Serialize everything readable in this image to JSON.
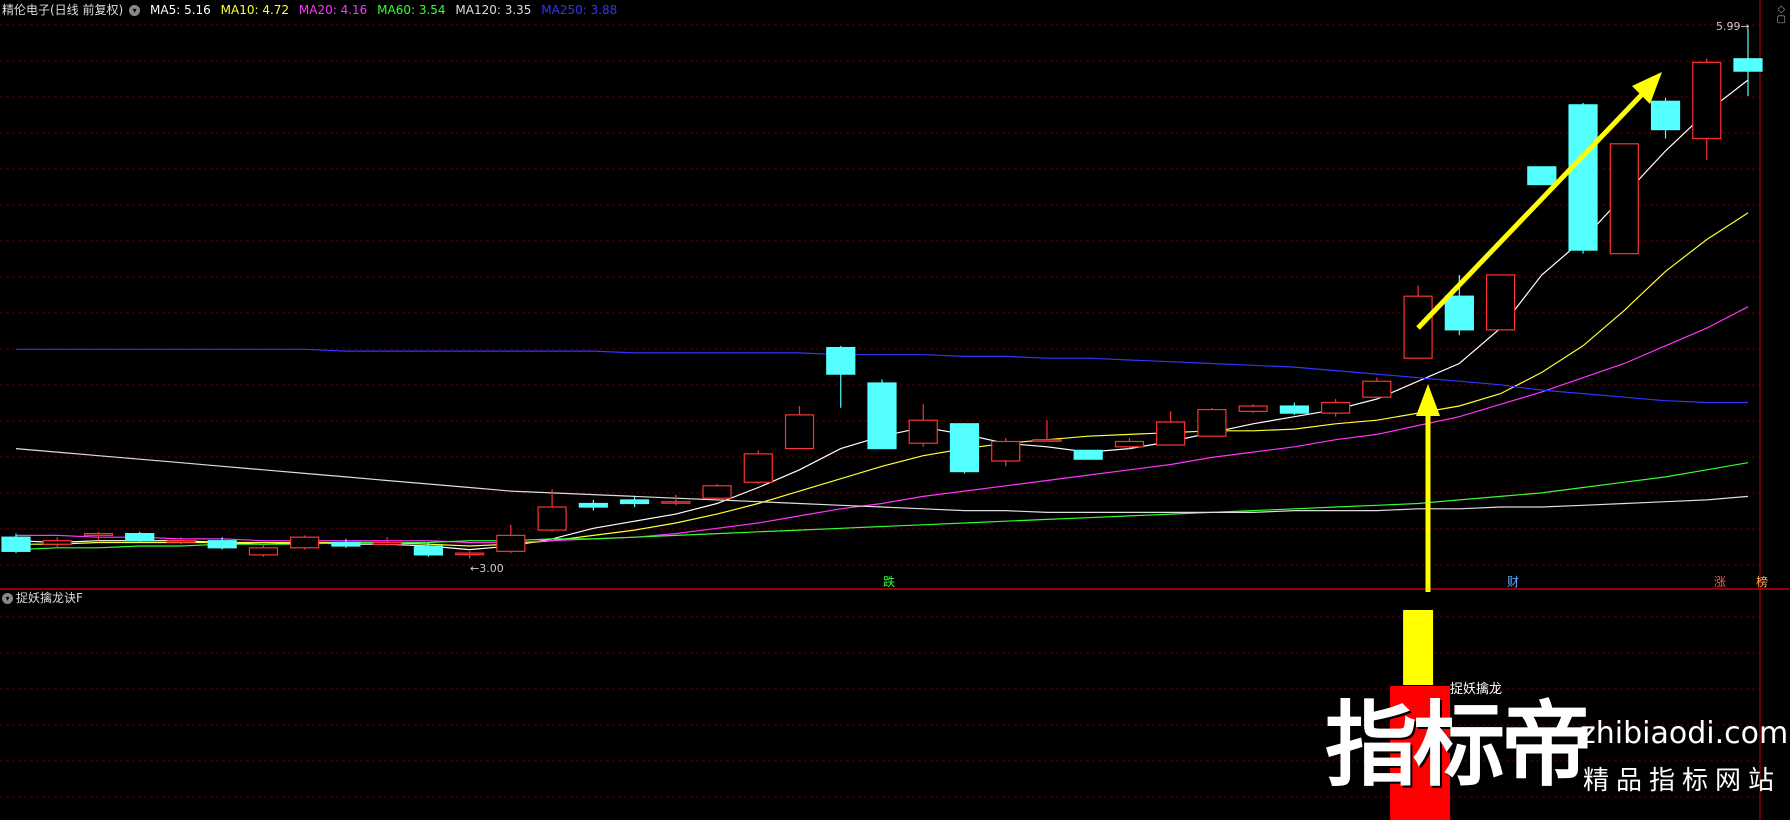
{
  "header": {
    "stock_name": "精伦电子(日线 前复权)",
    "ma": [
      {
        "label": "MA5: 5.16",
        "color": "#ffffff"
      },
      {
        "label": "MA10: 4.72",
        "color": "#ffff33"
      },
      {
        "label": "MA20: 4.16",
        "color": "#ff33ff"
      },
      {
        "label": "MA60: 3.54",
        "color": "#33ff33"
      },
      {
        "label": "MA120: 3.35",
        "color": "#dddddd"
      },
      {
        "label": "MA250: 3.88",
        "color": "#3333ff"
      }
    ]
  },
  "sub_indicator": {
    "title": "捉妖擒龙诀F",
    "signal_label": "捉妖擒龙"
  },
  "markers": [
    {
      "text": "跌",
      "color": "#33ff33"
    },
    {
      "text": "财",
      "color": "#66aaff"
    },
    {
      "text": "涨",
      "color": "#ff5555"
    },
    {
      "text": "榜",
      "color": "#ffaa55"
    }
  ],
  "watermark": {
    "cn": "指标帝",
    "en": "zhibiaodi.com",
    "sub": "精品指标网站"
  },
  "chart_data": {
    "type": "candlestick",
    "title": "",
    "ylim": [
      2.85,
      6.05
    ],
    "high_label": "5.99",
    "low_label": "3.00",
    "candles": [
      [
        3.12,
        3.04,
        3.14,
        3.03
      ],
      [
        3.08,
        3.1,
        3.12,
        3.06
      ],
      [
        3.13,
        3.14,
        3.15,
        3.1
      ],
      [
        3.14,
        3.1,
        3.15,
        3.09
      ],
      [
        3.1,
        3.1,
        3.12,
        3.08
      ],
      [
        3.1,
        3.06,
        3.12,
        3.05
      ],
      [
        3.02,
        3.06,
        3.08,
        3.01
      ],
      [
        3.06,
        3.12,
        3.13,
        3.05
      ],
      [
        3.09,
        3.07,
        3.11,
        3.06
      ],
      [
        3.08,
        3.09,
        3.12,
        3.07
      ],
      [
        3.07,
        3.02,
        3.09,
        3.01
      ],
      [
        3.03,
        3.03,
        3.04,
        3.0
      ],
      [
        3.04,
        3.13,
        3.19,
        3.03
      ],
      [
        3.16,
        3.29,
        3.39,
        3.15
      ],
      [
        3.31,
        3.29,
        3.33,
        3.27
      ],
      [
        3.33,
        3.31,
        3.35,
        3.29
      ],
      [
        3.32,
        3.32,
        3.36,
        3.3
      ],
      [
        3.34,
        3.41,
        3.42,
        3.33
      ],
      [
        3.43,
        3.59,
        3.61,
        3.42
      ],
      [
        3.62,
        3.81,
        3.86,
        3.64
      ],
      [
        4.19,
        4.04,
        4.2,
        3.85
      ],
      [
        3.99,
        3.62,
        4.01,
        3.62
      ],
      [
        3.65,
        3.78,
        3.87,
        3.63
      ],
      [
        3.76,
        3.49,
        3.76,
        3.48
      ],
      [
        3.55,
        3.66,
        3.68,
        3.52
      ],
      [
        3.67,
        3.67,
        3.78,
        3.66
      ],
      [
        3.61,
        3.56,
        3.6,
        3.59
      ],
      [
        3.63,
        3.66,
        3.68,
        3.62
      ],
      [
        3.64,
        3.77,
        3.83,
        3.66
      ],
      [
        3.69,
        3.84,
        3.85,
        3.72
      ],
      [
        3.83,
        3.86,
        3.87,
        3.82
      ],
      [
        3.86,
        3.82,
        3.88,
        3.81
      ],
      [
        3.82,
        3.88,
        3.9,
        3.8
      ],
      [
        3.91,
        4.0,
        4.02,
        3.93
      ],
      [
        4.13,
        4.48,
        4.54,
        4.13
      ],
      [
        4.48,
        4.29,
        4.6,
        4.26
      ],
      [
        4.29,
        4.6,
        4.6,
        4.29
      ],
      [
        5.21,
        5.11,
        5.11,
        5.11
      ],
      [
        5.56,
        4.74,
        5.57,
        4.72
      ],
      [
        4.72,
        5.34,
        5.34,
        4.72
      ],
      [
        5.58,
        5.42,
        5.6,
        5.37
      ],
      [
        5.37,
        5.8,
        5.82,
        5.25
      ],
      [
        5.82,
        5.75,
        5.99,
        5.61
      ]
    ],
    "series": [
      {
        "name": "MA5",
        "color": "#ffffff",
        "values": [
          3.1,
          3.09,
          3.1,
          3.1,
          3.1,
          3.09,
          3.08,
          3.09,
          3.08,
          3.08,
          3.07,
          3.05,
          3.07,
          3.11,
          3.17,
          3.21,
          3.25,
          3.31,
          3.4,
          3.5,
          3.62,
          3.69,
          3.74,
          3.7,
          3.65,
          3.63,
          3.6,
          3.62,
          3.66,
          3.71,
          3.76,
          3.8,
          3.84,
          3.9,
          4.0,
          4.1,
          4.3,
          4.6,
          4.8,
          5.05,
          5.3,
          5.52,
          5.7
        ]
      },
      {
        "name": "MA10",
        "color": "#ffff33",
        "values": [
          3.08,
          3.08,
          3.09,
          3.09,
          3.09,
          3.09,
          3.09,
          3.09,
          3.09,
          3.09,
          3.08,
          3.07,
          3.08,
          3.1,
          3.13,
          3.16,
          3.2,
          3.25,
          3.31,
          3.38,
          3.45,
          3.52,
          3.58,
          3.62,
          3.65,
          3.67,
          3.69,
          3.7,
          3.71,
          3.72,
          3.72,
          3.73,
          3.76,
          3.78,
          3.82,
          3.86,
          3.93,
          4.05,
          4.2,
          4.4,
          4.62,
          4.8,
          4.95
        ]
      },
      {
        "name": "MA20",
        "color": "#ff33ff",
        "values": [
          3.13,
          3.13,
          3.12,
          3.12,
          3.11,
          3.11,
          3.1,
          3.1,
          3.1,
          3.1,
          3.1,
          3.09,
          3.09,
          3.1,
          3.11,
          3.12,
          3.14,
          3.17,
          3.2,
          3.24,
          3.28,
          3.31,
          3.35,
          3.38,
          3.41,
          3.44,
          3.47,
          3.5,
          3.53,
          3.57,
          3.6,
          3.63,
          3.67,
          3.7,
          3.75,
          3.8,
          3.87,
          3.94,
          4.02,
          4.1,
          4.2,
          4.3,
          4.42
        ]
      },
      {
        "name": "MA60",
        "color": "#33ff33",
        "values": [
          3.05,
          3.06,
          3.06,
          3.07,
          3.07,
          3.08,
          3.08,
          3.08,
          3.09,
          3.09,
          3.09,
          3.1,
          3.1,
          3.11,
          3.11,
          3.12,
          3.13,
          3.14,
          3.15,
          3.16,
          3.17,
          3.18,
          3.19,
          3.2,
          3.21,
          3.22,
          3.23,
          3.24,
          3.25,
          3.26,
          3.27,
          3.28,
          3.29,
          3.3,
          3.31,
          3.33,
          3.35,
          3.37,
          3.4,
          3.43,
          3.46,
          3.5,
          3.54
        ]
      },
      {
        "name": "MA120",
        "color": "#dddddd",
        "values": [
          3.62,
          3.6,
          3.58,
          3.56,
          3.54,
          3.52,
          3.5,
          3.48,
          3.46,
          3.44,
          3.42,
          3.4,
          3.38,
          3.37,
          3.36,
          3.35,
          3.34,
          3.33,
          3.32,
          3.31,
          3.3,
          3.29,
          3.28,
          3.27,
          3.27,
          3.26,
          3.26,
          3.26,
          3.26,
          3.26,
          3.26,
          3.27,
          3.27,
          3.27,
          3.28,
          3.28,
          3.29,
          3.29,
          3.3,
          3.31,
          3.32,
          3.33,
          3.35
        ]
      },
      {
        "name": "MA250",
        "color": "#3333ff",
        "values": [
          4.18,
          4.18,
          4.18,
          4.18,
          4.18,
          4.18,
          4.18,
          4.18,
          4.17,
          4.17,
          4.17,
          4.17,
          4.17,
          4.17,
          4.17,
          4.16,
          4.16,
          4.16,
          4.16,
          4.16,
          4.15,
          4.15,
          4.15,
          4.14,
          4.14,
          4.13,
          4.13,
          4.12,
          4.11,
          4.1,
          4.09,
          4.08,
          4.06,
          4.04,
          4.02,
          4.0,
          3.98,
          3.95,
          3.93,
          3.91,
          3.89,
          3.88,
          3.88
        ]
      }
    ],
    "signal_bar": {
      "candle_index": 34
    }
  }
}
